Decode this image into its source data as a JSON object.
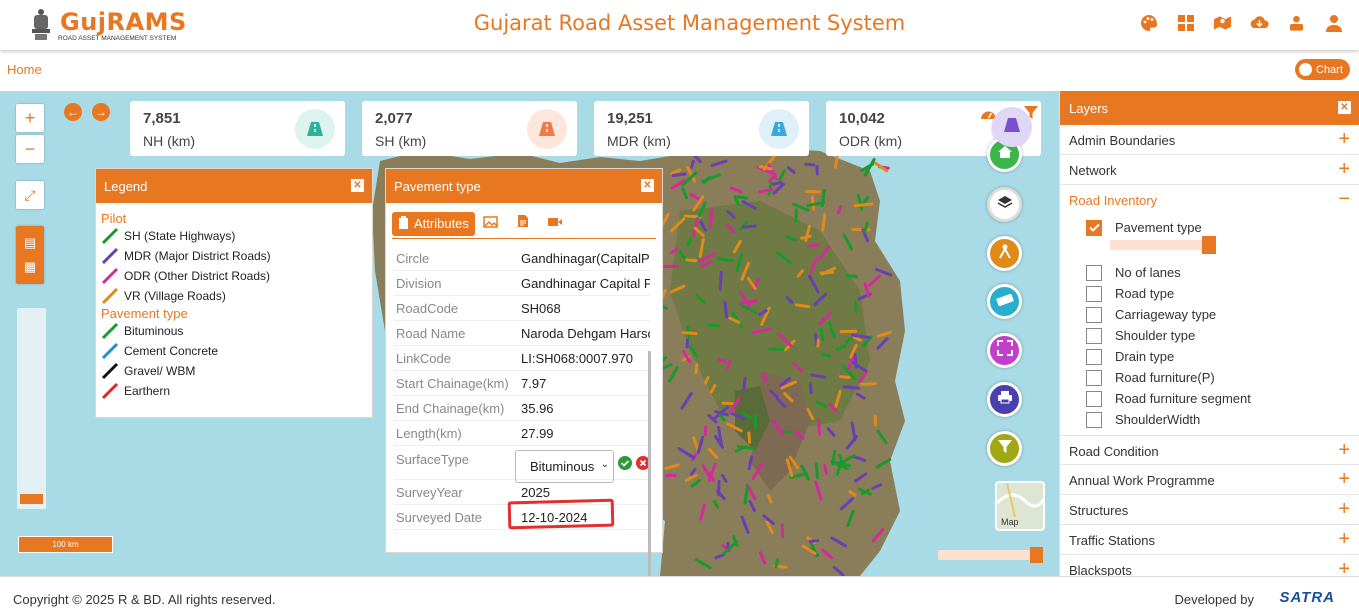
{
  "header": {
    "logo_text": "GujRAMS",
    "logo_tagline": "ROAD ASSET MANAGEMENT SYSTEM",
    "title": "Gujarat Road Asset Management System",
    "icons": [
      "palette-icon",
      "grid-icon",
      "map-marker-icon",
      "cloud-download-icon",
      "users-icon",
      "user-icon"
    ]
  },
  "breadcrumb": {
    "home": "Home"
  },
  "chart_toggle": {
    "label": "Chart"
  },
  "colors": {
    "accent": "#e87722",
    "sh": "#1a9a2a",
    "mdr": "#6a3fb5",
    "odr": "#d42a9a",
    "vr": "#e08a1a",
    "bituminous": "#1a9a2a",
    "cement_concrete": "#1e8fd6",
    "gravel": "#111111",
    "earthern": "#d42a2a"
  },
  "map": {
    "zoom_in": "+",
    "zoom_out": "−",
    "scale_label": "100 km",
    "map_thumb_label": "Map"
  },
  "stats": [
    {
      "value": "7,851",
      "label": "NH (km)",
      "color": "#2bb39a",
      "bg": "#ddf3ee"
    },
    {
      "value": "2,077",
      "label": "SH (km)",
      "color": "#f07a4a",
      "bg": "#fde6dc"
    },
    {
      "value": "19,251",
      "label": "MDR (km)",
      "color": "#3aa8e0",
      "bg": "#dff0fa"
    },
    {
      "value": "10,042",
      "label": "ODR (km)",
      "color": "#7a4fd0",
      "bg": "#e9e0f8"
    }
  ],
  "legend": {
    "title": "Legend",
    "groups": [
      {
        "title": "Pilot",
        "items": [
          {
            "label": "SH (State Highways)",
            "color": "#1a9a2a"
          },
          {
            "label": "MDR (Major District Roads)",
            "color": "#6a3fb5"
          },
          {
            "label": "ODR (Other District Roads)",
            "color": "#d42a9a"
          },
          {
            "label": "VR (Village Roads)",
            "color": "#e08a1a"
          }
        ]
      },
      {
        "title": "Pavement type",
        "items": [
          {
            "label": "Bituminous",
            "color": "#1a9a2a"
          },
          {
            "label": "Cement Concrete",
            "color": "#1e8fd6"
          },
          {
            "label": "Gravel/ WBM",
            "color": "#111111"
          },
          {
            "label": "Earthern",
            "color": "#d42a2a"
          }
        ]
      }
    ]
  },
  "popup": {
    "title": "Pavement type",
    "tab_attributes": "Attributes",
    "rows": [
      {
        "key": "Circle",
        "value": "Gandhinagar(CapitalProject)"
      },
      {
        "key": "Division",
        "value": "Gandhinagar Capital Project"
      },
      {
        "key": "RoadCode",
        "value": "SH068"
      },
      {
        "key": "Road Name",
        "value": "Naroda Dehgam Harsol"
      },
      {
        "key": "LinkCode",
        "value": "LI:SH068:0007.970"
      },
      {
        "key": "Start Chainage(km)",
        "value": "7.97"
      },
      {
        "key": "End Chainage(km)",
        "value": "35.96"
      },
      {
        "key": "Length(km)",
        "value": "27.99"
      }
    ],
    "surface_type_label": "SurfaceType",
    "surface_type_value": "Bituminous",
    "survey_year_label": "SurveyYear",
    "survey_year_value": "2025",
    "surveyed_date_label": "Surveyed Date",
    "surveyed_date_value": "12-10-2024"
  },
  "layers": {
    "title": "Layers",
    "sections_top": [
      {
        "label": "Admin Boundaries"
      },
      {
        "label": "Network"
      }
    ],
    "road_inventory": {
      "label": "Road Inventory",
      "pavement": "Pavement type",
      "items": [
        "No of lanes",
        "Road type",
        "Carriageway type",
        "Shoulder type",
        "Drain type",
        "Road furniture(P)",
        "Road furniture segment",
        "ShoulderWidth"
      ]
    },
    "sections_bottom": [
      {
        "label": "Road Condition"
      },
      {
        "label": "Annual Work Programme"
      },
      {
        "label": "Structures"
      },
      {
        "label": "Traffic Stations"
      },
      {
        "label": "Blackspots"
      }
    ]
  },
  "footer": {
    "copyright": "Copyright © 2025 R & BD. All rights reserved.",
    "developed_by": "Developed by",
    "developer": "SATRA"
  }
}
